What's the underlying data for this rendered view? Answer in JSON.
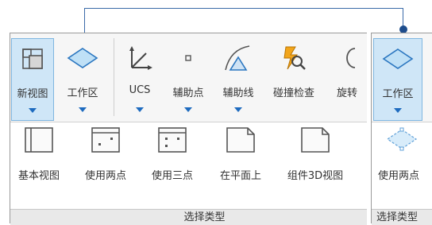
{
  "left_panel": {
    "ribbon_tools": [
      {
        "label": "新视图",
        "icon": "new-view-icon",
        "dropdown": true,
        "active": true
      },
      {
        "label": "工作区",
        "icon": "workplane-diamond-icon",
        "dropdown": true,
        "active": false
      },
      {
        "label": "UCS",
        "icon": "ucs-axes-icon",
        "dropdown": true,
        "active": false
      },
      {
        "label": "辅助点",
        "icon": "aux-point-icon",
        "dropdown": true,
        "active": false
      },
      {
        "label": "辅助线",
        "icon": "aux-line-icon",
        "dropdown": true,
        "active": false
      },
      {
        "label": "碰撞检查",
        "icon": "collision-check-icon",
        "dropdown": false,
        "active": false
      },
      {
        "label": "旋转",
        "icon": "rotate-icon",
        "dropdown": false,
        "active": false
      }
    ],
    "view_type_tools": [
      {
        "label": "基本视图",
        "icon": "basic-view-icon"
      },
      {
        "label": "使用两点",
        "icon": "two-point-view-icon"
      },
      {
        "label": "使用三点",
        "icon": "three-point-view-icon"
      },
      {
        "label": "在平面上",
        "icon": "on-plane-icon"
      },
      {
        "label": "组件3D视图",
        "icon": "component-3d-view-icon"
      }
    ],
    "footer_label": "选择类型"
  },
  "right_panel": {
    "ribbon_tool": {
      "label": "工作区",
      "icon": "workplane-diamond-icon",
      "dropdown": true,
      "active": true
    },
    "view_type_tool": {
      "label": "使用两点",
      "icon": "two-point-diamond-icon"
    },
    "footer_label": "选择类型"
  },
  "colors": {
    "accent_blue": "#1e6bbf",
    "active_fill": "#cfe6f7",
    "connector": "#3a6aa8"
  }
}
